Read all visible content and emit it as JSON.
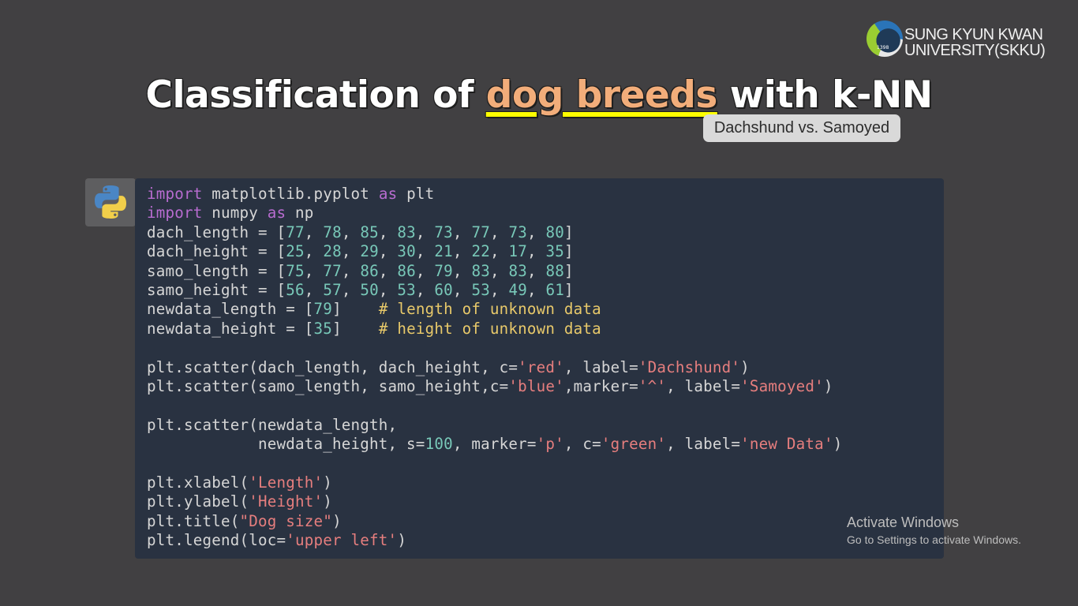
{
  "logo": {
    "line1": "SUNG KYUN KWAN",
    "line2": "UNIVERSITY(SKKU)",
    "year": "1398"
  },
  "title": {
    "before": "Classification of ",
    "highlight": "dog breeds",
    "after": " with k-NN"
  },
  "badge": "Dachshund vs. Samoyed",
  "icon": "python-logo-icon",
  "colors": {
    "background": "#414042",
    "code_panel": "#293241",
    "keyword": "#b86cd0",
    "number": "#78c8b8",
    "string": "#e67e7e",
    "comment": "#e8c96a",
    "highlight_text": "#f2ad7a",
    "underline": "#ffff00"
  },
  "code": {
    "lines": [
      [
        {
          "t": "import",
          "c": "kw"
        },
        {
          "t": " matplotlib.pyplot "
        },
        {
          "t": "as",
          "c": "kw"
        },
        {
          "t": " plt"
        }
      ],
      [
        {
          "t": "import",
          "c": "kw"
        },
        {
          "t": " numpy "
        },
        {
          "t": "as",
          "c": "kw"
        },
        {
          "t": " np"
        }
      ],
      [
        {
          "t": "dach_length = ["
        },
        {
          "t": "77",
          "c": "num"
        },
        {
          "t": ", "
        },
        {
          "t": "78",
          "c": "num"
        },
        {
          "t": ", "
        },
        {
          "t": "85",
          "c": "num"
        },
        {
          "t": ", "
        },
        {
          "t": "83",
          "c": "num"
        },
        {
          "t": ", "
        },
        {
          "t": "73",
          "c": "num"
        },
        {
          "t": ", "
        },
        {
          "t": "77",
          "c": "num"
        },
        {
          "t": ", "
        },
        {
          "t": "73",
          "c": "num"
        },
        {
          "t": ", "
        },
        {
          "t": "80",
          "c": "num"
        },
        {
          "t": "]"
        }
      ],
      [
        {
          "t": "dach_height = ["
        },
        {
          "t": "25",
          "c": "num"
        },
        {
          "t": ", "
        },
        {
          "t": "28",
          "c": "num"
        },
        {
          "t": ", "
        },
        {
          "t": "29",
          "c": "num"
        },
        {
          "t": ", "
        },
        {
          "t": "30",
          "c": "num"
        },
        {
          "t": ", "
        },
        {
          "t": "21",
          "c": "num"
        },
        {
          "t": ", "
        },
        {
          "t": "22",
          "c": "num"
        },
        {
          "t": ", "
        },
        {
          "t": "17",
          "c": "num"
        },
        {
          "t": ", "
        },
        {
          "t": "35",
          "c": "num"
        },
        {
          "t": "]"
        }
      ],
      [
        {
          "t": "samo_length = ["
        },
        {
          "t": "75",
          "c": "num"
        },
        {
          "t": ", "
        },
        {
          "t": "77",
          "c": "num"
        },
        {
          "t": ", "
        },
        {
          "t": "86",
          "c": "num"
        },
        {
          "t": ", "
        },
        {
          "t": "86",
          "c": "num"
        },
        {
          "t": ", "
        },
        {
          "t": "79",
          "c": "num"
        },
        {
          "t": ", "
        },
        {
          "t": "83",
          "c": "num"
        },
        {
          "t": ", "
        },
        {
          "t": "83",
          "c": "num"
        },
        {
          "t": ", "
        },
        {
          "t": "88",
          "c": "num"
        },
        {
          "t": "]"
        }
      ],
      [
        {
          "t": "samo_height = ["
        },
        {
          "t": "56",
          "c": "num"
        },
        {
          "t": ", "
        },
        {
          "t": "57",
          "c": "num"
        },
        {
          "t": ", "
        },
        {
          "t": "50",
          "c": "num"
        },
        {
          "t": ", "
        },
        {
          "t": "53",
          "c": "num"
        },
        {
          "t": ", "
        },
        {
          "t": "60",
          "c": "num"
        },
        {
          "t": ", "
        },
        {
          "t": "53",
          "c": "num"
        },
        {
          "t": ", "
        },
        {
          "t": "49",
          "c": "num"
        },
        {
          "t": ", "
        },
        {
          "t": "61",
          "c": "num"
        },
        {
          "t": "]"
        }
      ],
      [
        {
          "t": "newdata_length = ["
        },
        {
          "t": "79",
          "c": "num"
        },
        {
          "t": "]    "
        },
        {
          "t": "# length of unknown data",
          "c": "cmt"
        }
      ],
      [
        {
          "t": "newdata_height = ["
        },
        {
          "t": "35",
          "c": "num"
        },
        {
          "t": "]    "
        },
        {
          "t": "# height of unknown data",
          "c": "cmt"
        }
      ],
      [],
      [
        {
          "t": "plt.scatter(dach_length, dach_height, c="
        },
        {
          "t": "'red'",
          "c": "str"
        },
        {
          "t": ", label="
        },
        {
          "t": "'Dachshund'",
          "c": "str"
        },
        {
          "t": ")"
        }
      ],
      [
        {
          "t": "plt.scatter(samo_length, samo_height,c="
        },
        {
          "t": "'blue'",
          "c": "str"
        },
        {
          "t": ",marker="
        },
        {
          "t": "'^'",
          "c": "str"
        },
        {
          "t": ", label="
        },
        {
          "t": "'Samoyed'",
          "c": "str"
        },
        {
          "t": ")"
        }
      ],
      [],
      [
        {
          "t": "plt.scatter(newdata_length,"
        }
      ],
      [
        {
          "t": "            newdata_height, s="
        },
        {
          "t": "100",
          "c": "num"
        },
        {
          "t": ", marker="
        },
        {
          "t": "'p'",
          "c": "str"
        },
        {
          "t": ", c="
        },
        {
          "t": "'green'",
          "c": "str"
        },
        {
          "t": ", label="
        },
        {
          "t": "'new Data'",
          "c": "str"
        },
        {
          "t": ")"
        }
      ],
      [],
      [
        {
          "t": "plt.xlabel("
        },
        {
          "t": "'Length'",
          "c": "str"
        },
        {
          "t": ")"
        }
      ],
      [
        {
          "t": "plt.ylabel("
        },
        {
          "t": "'Height'",
          "c": "str"
        },
        {
          "t": ")"
        }
      ],
      [
        {
          "t": "plt.title("
        },
        {
          "t": "\"Dog size\"",
          "c": "str"
        },
        {
          "t": ")"
        }
      ],
      [
        {
          "t": "plt.legend(loc="
        },
        {
          "t": "'upper left'",
          "c": "str"
        },
        {
          "t": ")"
        }
      ]
    ]
  },
  "watermark": {
    "title": "Activate Windows",
    "subtitle": "Go to Settings to activate Windows."
  }
}
